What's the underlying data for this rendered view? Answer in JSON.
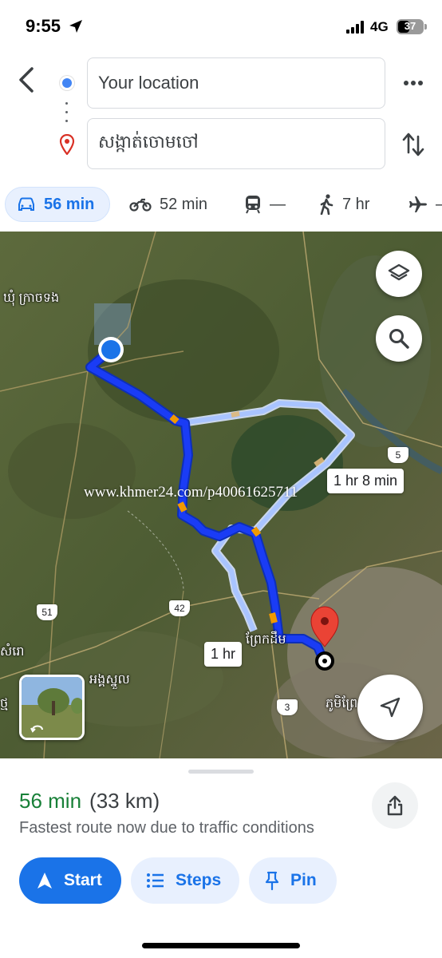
{
  "status_bar": {
    "time": "9:55",
    "network": "4G",
    "battery": "37"
  },
  "directions": {
    "origin": "Your location",
    "destination": "សង្កាត់ចោមចៅ"
  },
  "modes": {
    "drive": "56 min",
    "motorcycle": "52 min",
    "transit": "—",
    "walk": "7 hr",
    "flight": "–"
  },
  "map": {
    "labels": {
      "village_north": "ឃុំ ក្រាចទង",
      "district_west": "សំរោ",
      "angkor_snuol": "អង្គស្នួល",
      "town_center": "ព្រែកដឹម",
      "phum": "ភូមិព្រែ",
      "west_edge": "ថ្ម"
    },
    "alt_route_1": "1 hr 8 min",
    "alt_route_2": "1 hr",
    "road_shields": [
      "5",
      "42",
      "51",
      "3"
    ],
    "watermark": "www.khmer24.com/p40061625711",
    "colors": {
      "main_route": "#1a3cf5",
      "alt_route": "#a9c4ff",
      "traffic": "#f29900"
    }
  },
  "sheet": {
    "time": "56 min",
    "distance": "(33 km)",
    "reason": "Fastest route now due to traffic conditions",
    "start": "Start",
    "steps": "Steps",
    "pin": "Pin"
  }
}
